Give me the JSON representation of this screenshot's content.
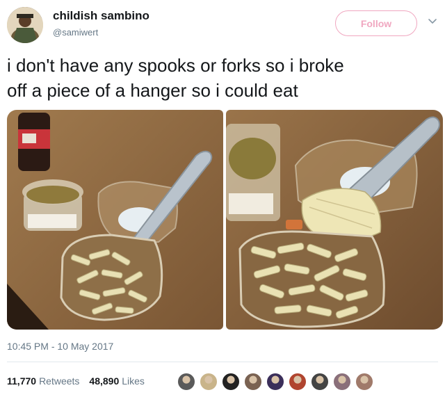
{
  "author": {
    "name": "childish sambino",
    "handle": "@samiwert"
  },
  "follow_button": {
    "label": "Follow"
  },
  "tweet": {
    "text_line1": "i don't have any spooks or forks so i broke",
    "text_line2": "off a piece of a hanger so i could eat"
  },
  "meta": {
    "timestamp": "10:45 PM - 10 May 2017"
  },
  "stats": {
    "retweets_count": "11,770",
    "retweets_label": "Retweets",
    "likes_count": "48,890",
    "likes_label": "Likes"
  },
  "icons": {
    "more": "chevron-down-icon"
  },
  "colors": {
    "follow_pink": "#f0a7c0",
    "muted": "#657786",
    "text": "#14171a"
  },
  "likers": [
    {
      "color": "#5a5a5a"
    },
    {
      "color": "#c9b48a"
    },
    {
      "color": "#222222"
    },
    {
      "color": "#7a6252"
    },
    {
      "color": "#3b2f5a"
    },
    {
      "color": "#b0452f"
    },
    {
      "color": "#444444"
    },
    {
      "color": "#8a6f7a"
    },
    {
      "color": "#a07a6a"
    }
  ]
}
